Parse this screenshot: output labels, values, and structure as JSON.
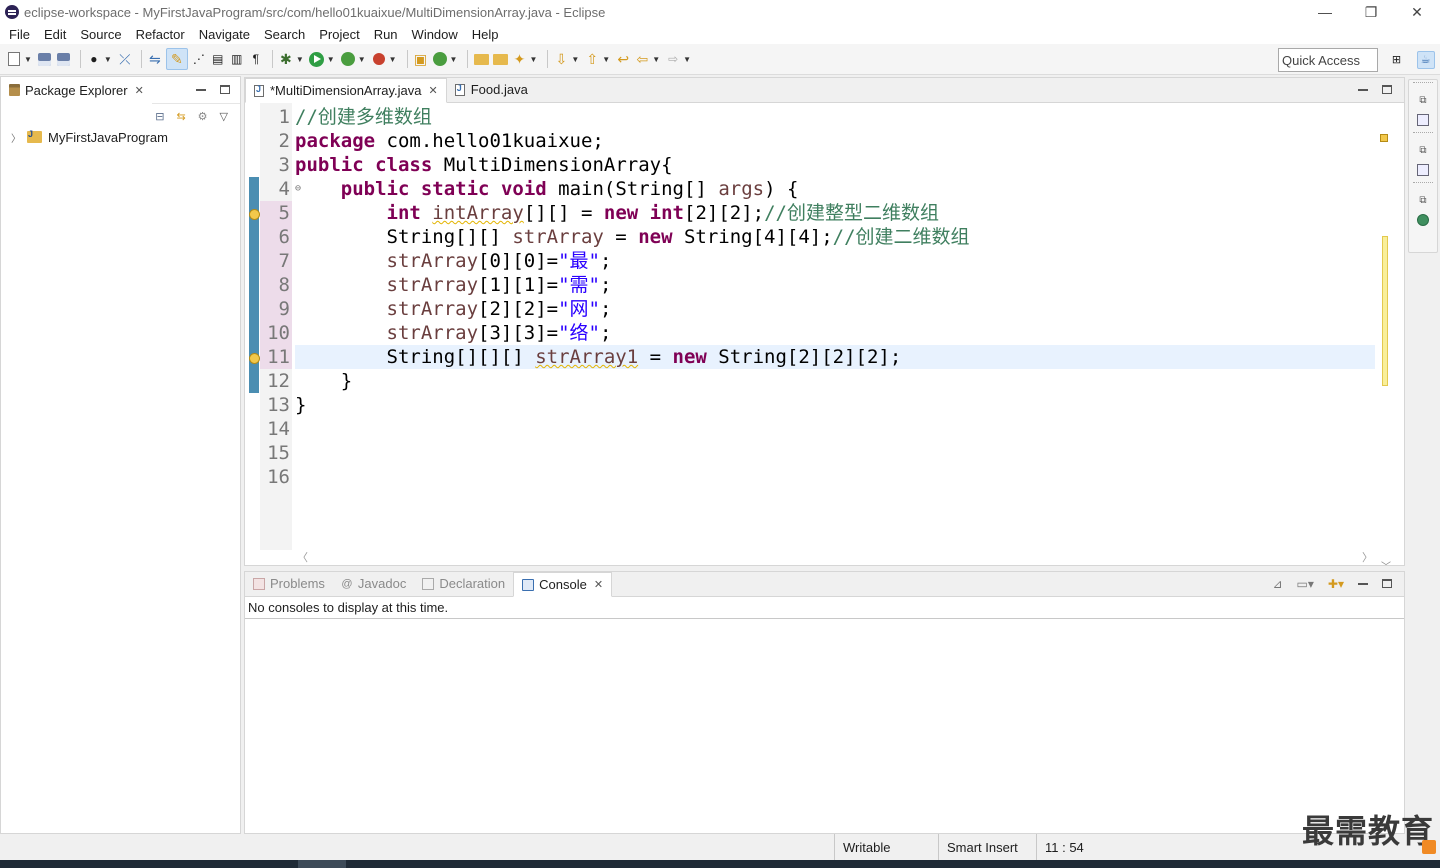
{
  "window": {
    "title": "eclipse-workspace - MyFirstJavaProgram/src/com/hello01kuaixue/MultiDimensionArray.java - Eclipse",
    "minimize": "—",
    "restore": "❐",
    "close": "✕"
  },
  "menu": [
    "File",
    "Edit",
    "Source",
    "Refactor",
    "Navigate",
    "Search",
    "Project",
    "Run",
    "Window",
    "Help"
  ],
  "toolbar": {
    "quick_access": "Quick Access"
  },
  "package_explorer": {
    "tab_label": "Package Explorer",
    "tree": [
      {
        "label": "MyFirstJavaProgram",
        "expanded": false
      }
    ]
  },
  "editor": {
    "tabs": [
      {
        "label": "*MultiDimensionArray.java",
        "active": true,
        "dirty": true
      },
      {
        "label": "Food.java",
        "active": false
      }
    ],
    "line_numbers": [
      "1",
      "2",
      "3",
      "4",
      "5",
      "6",
      "7",
      "8",
      "9",
      "10",
      "11",
      "12",
      "13",
      "14",
      "15",
      "16"
    ],
    "current_line": 11,
    "warning_lines": [
      5,
      11
    ],
    "code": [
      [
        {
          "t": "cm",
          "v": "//创建多维数组"
        }
      ],
      [
        {
          "t": "kw",
          "v": "package"
        },
        {
          "t": "plain",
          "v": " com.hello01kuaixue;"
        }
      ],
      [
        {
          "t": "kw",
          "v": "public"
        },
        {
          "t": "plain",
          "v": " "
        },
        {
          "t": "kw",
          "v": "class"
        },
        {
          "t": "plain",
          "v": " MultiDimensionArray{"
        }
      ],
      [
        {
          "t": "plain",
          "v": "    "
        },
        {
          "t": "kw",
          "v": "public"
        },
        {
          "t": "plain",
          "v": " "
        },
        {
          "t": "kw",
          "v": "static"
        },
        {
          "t": "plain",
          "v": " "
        },
        {
          "t": "kw",
          "v": "void"
        },
        {
          "t": "plain",
          "v": " main(String[] "
        },
        {
          "t": "var",
          "v": "args"
        },
        {
          "t": "plain",
          "v": ") {"
        }
      ],
      [
        {
          "t": "plain",
          "v": "        "
        },
        {
          "t": "kw",
          "v": "int"
        },
        {
          "t": "plain",
          "v": " "
        },
        {
          "t": "var warnvar",
          "v": "intArray"
        },
        {
          "t": "plain",
          "v": "[][] = "
        },
        {
          "t": "kw",
          "v": "new"
        },
        {
          "t": "plain",
          "v": " "
        },
        {
          "t": "kw",
          "v": "int"
        },
        {
          "t": "plain",
          "v": "[2][2];"
        },
        {
          "t": "cm",
          "v": "//创建整型二维数组"
        }
      ],
      [
        {
          "t": "plain",
          "v": "        String[][] "
        },
        {
          "t": "var",
          "v": "strArray"
        },
        {
          "t": "plain",
          "v": " = "
        },
        {
          "t": "kw",
          "v": "new"
        },
        {
          "t": "plain",
          "v": " String[4][4];"
        },
        {
          "t": "cm",
          "v": "//创建二维数组"
        }
      ],
      [
        {
          "t": "plain",
          "v": "        "
        },
        {
          "t": "var",
          "v": "strArray"
        },
        {
          "t": "plain",
          "v": "[0][0]="
        },
        {
          "t": "str",
          "v": "\"最\""
        },
        {
          "t": "plain",
          "v": ";"
        }
      ],
      [
        {
          "t": "plain",
          "v": "        "
        },
        {
          "t": "var",
          "v": "strArray"
        },
        {
          "t": "plain",
          "v": "[1][1]="
        },
        {
          "t": "str",
          "v": "\"需\""
        },
        {
          "t": "plain",
          "v": ";"
        }
      ],
      [
        {
          "t": "plain",
          "v": "        "
        },
        {
          "t": "var",
          "v": "strArray"
        },
        {
          "t": "plain",
          "v": "[2][2]="
        },
        {
          "t": "str",
          "v": "\"网\""
        },
        {
          "t": "plain",
          "v": ";"
        }
      ],
      [
        {
          "t": "plain",
          "v": "        "
        },
        {
          "t": "var",
          "v": "strArray"
        },
        {
          "t": "plain",
          "v": "[3][3]="
        },
        {
          "t": "str",
          "v": "\"络\""
        },
        {
          "t": "plain",
          "v": ";"
        }
      ],
      [
        {
          "t": "plain",
          "v": "        String[][][] "
        },
        {
          "t": "var warnvar",
          "v": "strArray1"
        },
        {
          "t": "plain",
          "v": " = "
        },
        {
          "t": "kw",
          "v": "new"
        },
        {
          "t": "plain",
          "v": " String[2][2][2];"
        }
      ],
      [
        {
          "t": "plain",
          "v": "    }"
        }
      ],
      [
        {
          "t": "plain",
          "v": "}"
        }
      ],
      [],
      [],
      []
    ]
  },
  "bottom_panel": {
    "tabs": [
      {
        "label": "Problems",
        "active": false
      },
      {
        "label": "Javadoc",
        "active": false
      },
      {
        "label": "Declaration",
        "active": false
      },
      {
        "label": "Console",
        "active": true
      }
    ],
    "message": "No consoles to display at this time."
  },
  "statusbar": {
    "writable": "Writable",
    "insert_mode": "Smart Insert",
    "position": "11 : 54"
  },
  "watermark": "最需教育",
  "colors": {
    "keyword": "#7f0055",
    "comment": "#3f7f5f",
    "string": "#2a00ff",
    "variable": "#6a3e3e",
    "current_line": "#e8f2fe"
  }
}
